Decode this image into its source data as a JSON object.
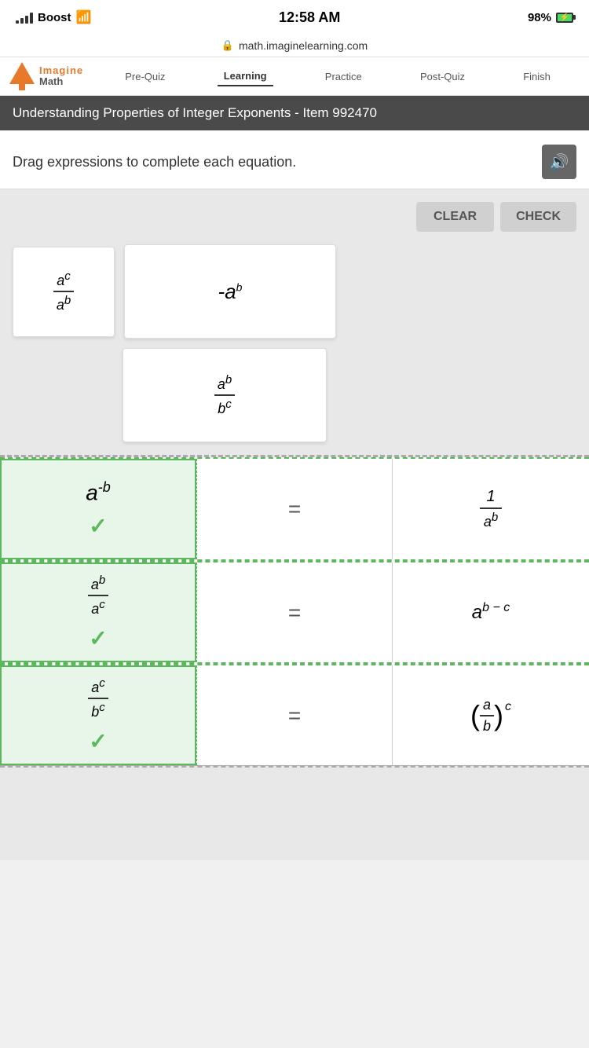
{
  "status_bar": {
    "carrier": "Boost",
    "time": "12:58 AM",
    "battery_pct": "98%",
    "url": "math.imaginelearning.com",
    "lock_symbol": "🔒"
  },
  "nav": {
    "logo_imagine": "Imagine",
    "logo_math": "Math",
    "tabs": [
      {
        "label": "Pre-Quiz",
        "active": false
      },
      {
        "label": "Learning",
        "active": true
      },
      {
        "label": "Practice",
        "active": false
      },
      {
        "label": "Post-Quiz",
        "active": false
      },
      {
        "label": "Finish",
        "active": false
      }
    ]
  },
  "page_title": "Understanding Properties of Integer Exponents - Item 992470",
  "instruction": "Drag expressions to complete each equation.",
  "buttons": {
    "clear": "CLEAR",
    "check": "CHECK"
  },
  "drag_tiles": [
    {
      "id": "tile1",
      "type": "frac",
      "numer": "a",
      "numer_sup": "c",
      "denom": "a",
      "denom_sup": "b"
    },
    {
      "id": "tile2",
      "type": "neg_power",
      "base": "-a",
      "exp": "b"
    },
    {
      "id": "tile3",
      "type": "frac",
      "numer": "a",
      "numer_sup": "b",
      "denom": "b",
      "denom_sup": "c"
    }
  ],
  "equations": [
    {
      "left_type": "power_neg",
      "left_base": "a",
      "left_exp": "-b",
      "right_type": "frac_one",
      "right_num": "1",
      "right_denom_base": "a",
      "right_denom_exp": "b",
      "has_check": true
    },
    {
      "left_type": "frac",
      "left_numer": "a",
      "left_numer_exp": "b",
      "left_denom": "a",
      "left_denom_exp": "c",
      "right_type": "power_diff",
      "right_base": "a",
      "right_exp": "b − c",
      "has_check": true
    },
    {
      "left_type": "frac",
      "left_numer": "a",
      "left_numer_exp": "c",
      "left_denom": "b",
      "left_denom_exp": "c",
      "right_type": "paren_frac",
      "right_paren_n": "a",
      "right_paren_d": "b",
      "right_exp": "c",
      "has_check": true
    }
  ],
  "equals_sign": "=",
  "check_symbol": "✓"
}
